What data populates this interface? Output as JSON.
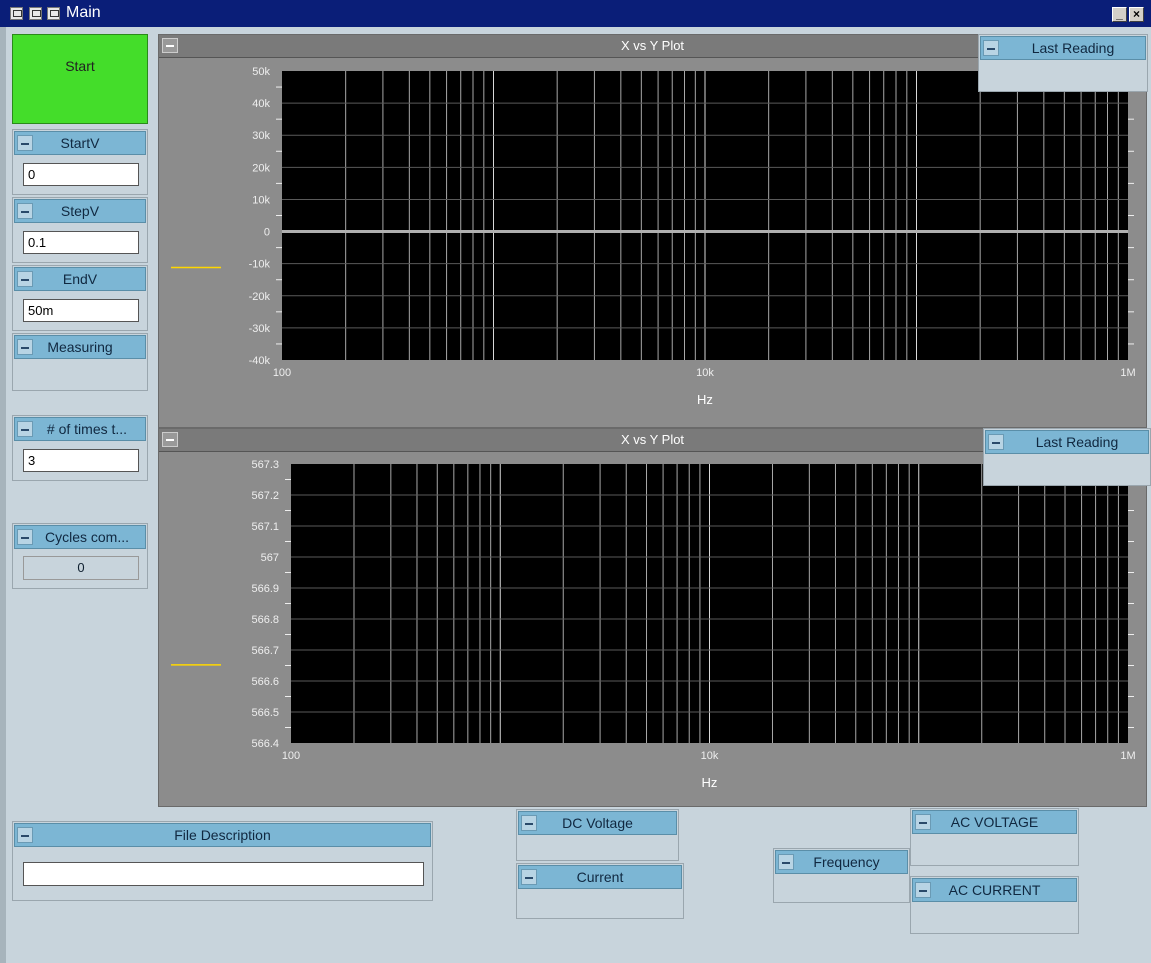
{
  "window": {
    "title": "Main"
  },
  "controls": {
    "start_label": "Start",
    "startv": {
      "label": "StartV",
      "value": "0"
    },
    "stepv": {
      "label": "StepV",
      "value": "0.1"
    },
    "endv": {
      "label": "EndV",
      "value": "50m"
    },
    "measuring": {
      "label": "Measuring"
    },
    "times": {
      "label": "# of times t...",
      "value": "3"
    },
    "cycles": {
      "label": "Cycles com...",
      "value": "0"
    }
  },
  "bottom": {
    "file_description": {
      "label": "File Description",
      "value": ""
    },
    "dc_voltage": {
      "label": "DC Voltage"
    },
    "current": {
      "label": "Current"
    },
    "frequency": {
      "label": "Frequency"
    },
    "ac_voltage": {
      "label": "AC VOLTAGE"
    },
    "ac_current": {
      "label": "AC CURRENT"
    }
  },
  "plots": [
    {
      "title": "X vs Y Plot",
      "last_reading_label": "Last Reading"
    },
    {
      "title": "X vs Y Plot",
      "last_reading_label": "Last Reading"
    }
  ],
  "chart_data": [
    {
      "type": "line",
      "title": "X vs Y Plot",
      "xlabel": "Hz",
      "ylabel": "",
      "xscale": "log",
      "xlim": [
        100,
        1000000
      ],
      "ylim": [
        -40000,
        50000
      ],
      "x_tick_labels": [
        "100",
        "10k",
        "1M"
      ],
      "y_tick_labels": [
        "50k",
        "40k",
        "30k",
        "20k",
        "10k",
        "0",
        "-10k",
        "-20k",
        "-30k",
        "-40k"
      ],
      "series": [
        {
          "values": [],
          "color": "#ffd700"
        }
      ],
      "background": "#000000",
      "grid": true
    },
    {
      "type": "line",
      "title": "X vs Y Plot",
      "xlabel": "Hz",
      "ylabel": "",
      "xscale": "log",
      "xlim": [
        100,
        1000000
      ],
      "ylim": [
        566.4,
        567.3
      ],
      "x_tick_labels": [
        "100",
        "10k",
        "1M"
      ],
      "y_tick_labels": [
        "567.3",
        "567.2",
        "567.1",
        "567",
        "566.9",
        "566.8",
        "566.7",
        "566.6",
        "566.5",
        "566.4"
      ],
      "series": [
        {
          "values": [],
          "color": "#ffd700"
        }
      ],
      "background": "#000000",
      "grid": true
    }
  ]
}
